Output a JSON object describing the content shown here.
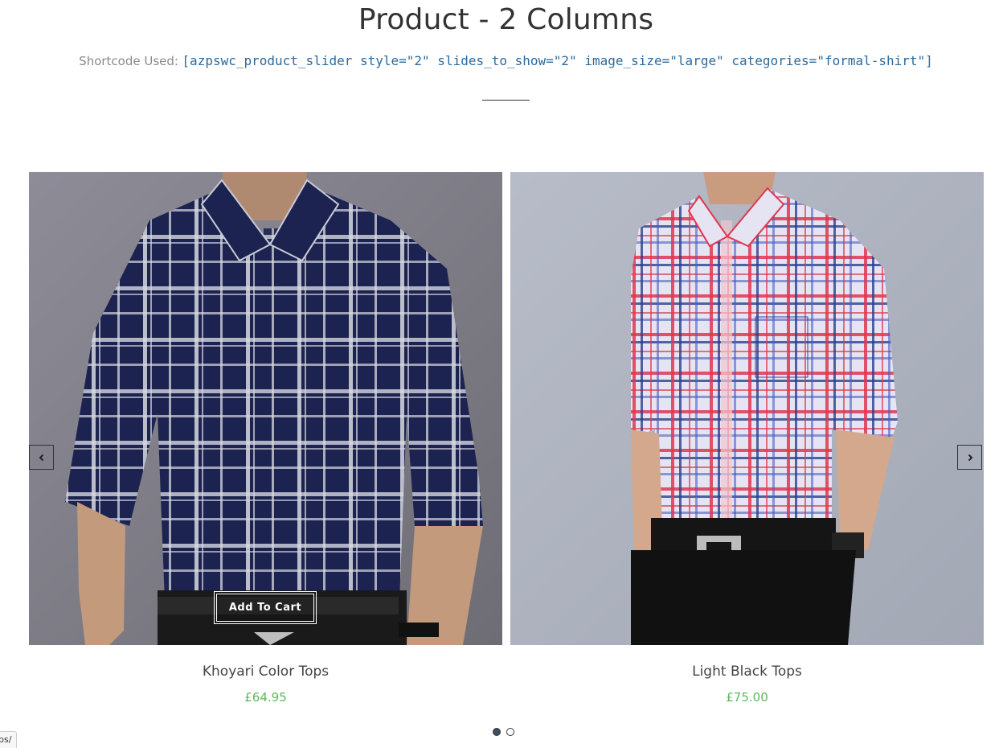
{
  "header": {
    "title": "Product - 2 Columns",
    "shortcode_label": "Shortcode Used:",
    "shortcode_value": "[azpswc_product_slider style=\"2\" slides_to_show=\"2\" image_size=\"large\" categories=\"formal-shirt\"]"
  },
  "slider": {
    "prev_icon": "chevron-left-icon",
    "next_icon": "chevron-right-icon",
    "products": [
      {
        "name": "Khoyari Color Tops",
        "price": "£64.95",
        "add_to_cart_label": "Add To Cart",
        "image_desc": "navy-white-plaid-shirt"
      },
      {
        "name": "Light Black Tops",
        "price": "£75.00",
        "image_desc": "red-blue-white-plaid-shirt"
      }
    ],
    "pagination": {
      "total": 2,
      "active": 1
    }
  },
  "status_bar": {
    "url_fragment": "ps/"
  },
  "colors": {
    "price": "#5cb85c",
    "shortcode": "#2b6a9e",
    "title": "#333333",
    "active_dot": "#3d4f63"
  }
}
